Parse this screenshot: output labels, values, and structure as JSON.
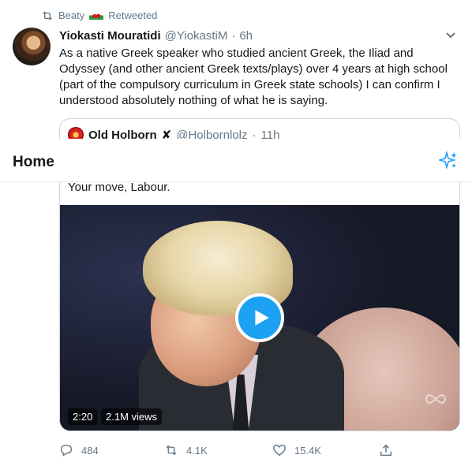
{
  "retweet": {
    "user": "Beaty",
    "label": "Retweeted",
    "flag_icon": "wales-flag-icon"
  },
  "tweet": {
    "name": "Yiokasti Mouratidi",
    "handle": "@YiokastiM",
    "separator": "·",
    "time": "6h",
    "text": "As a native Greek speaker who studied ancient Greek, the Iliad and Odyssey (and other ancient Greek texts/plays) over 4 years at high school (part of the compulsory curriculum in Greek state schools) I can confirm I understood absolutely nothing of what he is saying."
  },
  "quoted": {
    "name": "Old Holborn",
    "badge": "✘",
    "handle": "@Holbornlolz",
    "separator": "·",
    "time": "11h",
    "text": "Your move, Labour.",
    "video": {
      "duration": "2:20",
      "views": "2.1M views"
    }
  },
  "home": {
    "title": "Home"
  },
  "actions": {
    "replies": "484",
    "retweets": "4.1K",
    "likes": "15.4K"
  },
  "colors": {
    "accent": "#1da1f2",
    "muted": "#657786",
    "text": "#14171a",
    "border": "#ccd6dd"
  }
}
